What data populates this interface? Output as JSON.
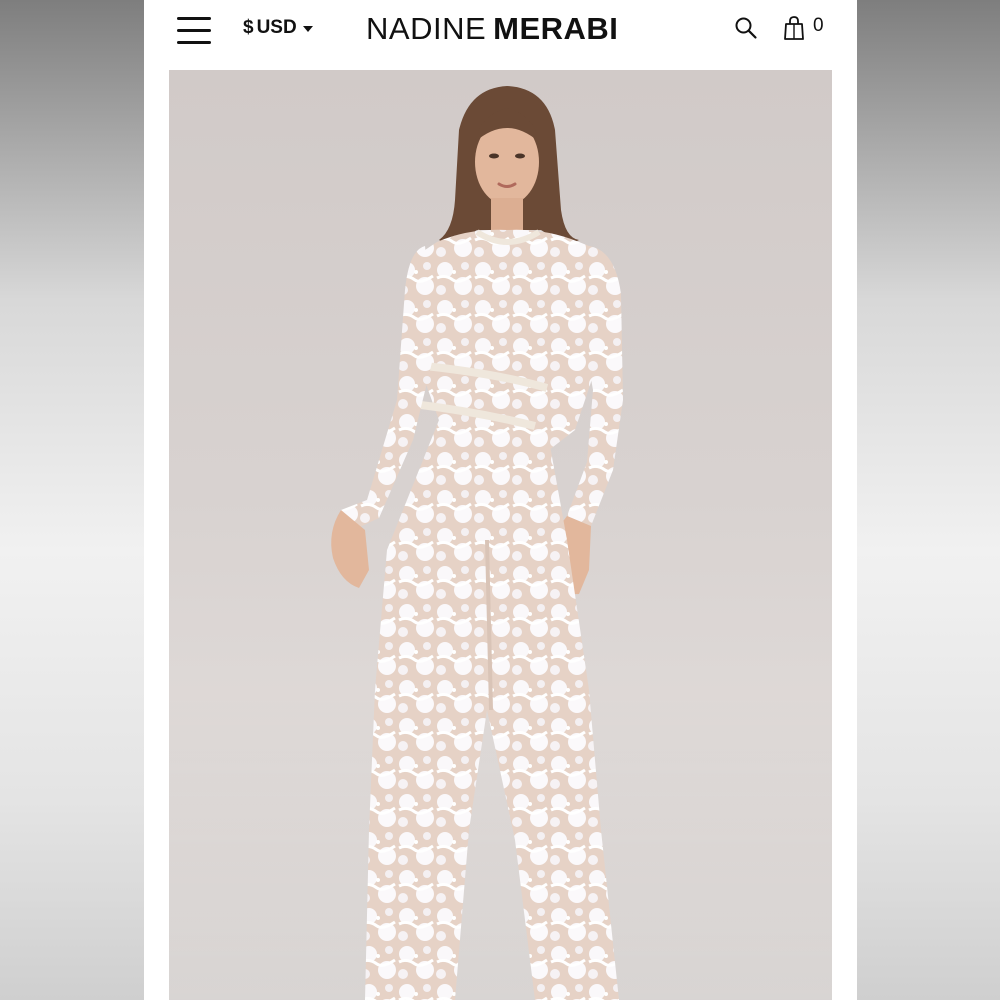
{
  "header": {
    "currency_symbol": "$",
    "currency_code": "USD",
    "brand_first": "NADINE",
    "brand_second": "MERABI",
    "cart_count": "0"
  },
  "icons": {
    "menu": "hamburger-menu-icon",
    "currency": "chevron-down-icon",
    "search": "search-icon",
    "cart": "shopping-bag-icon"
  },
  "product_image": {
    "subject": "model wearing long-sleeve white lace jumpsuit",
    "background_color": "#d6d0ce",
    "garment_color": "#f4f2f3"
  },
  "colors": {
    "page_background": "#ffffff",
    "text": "#111111"
  }
}
